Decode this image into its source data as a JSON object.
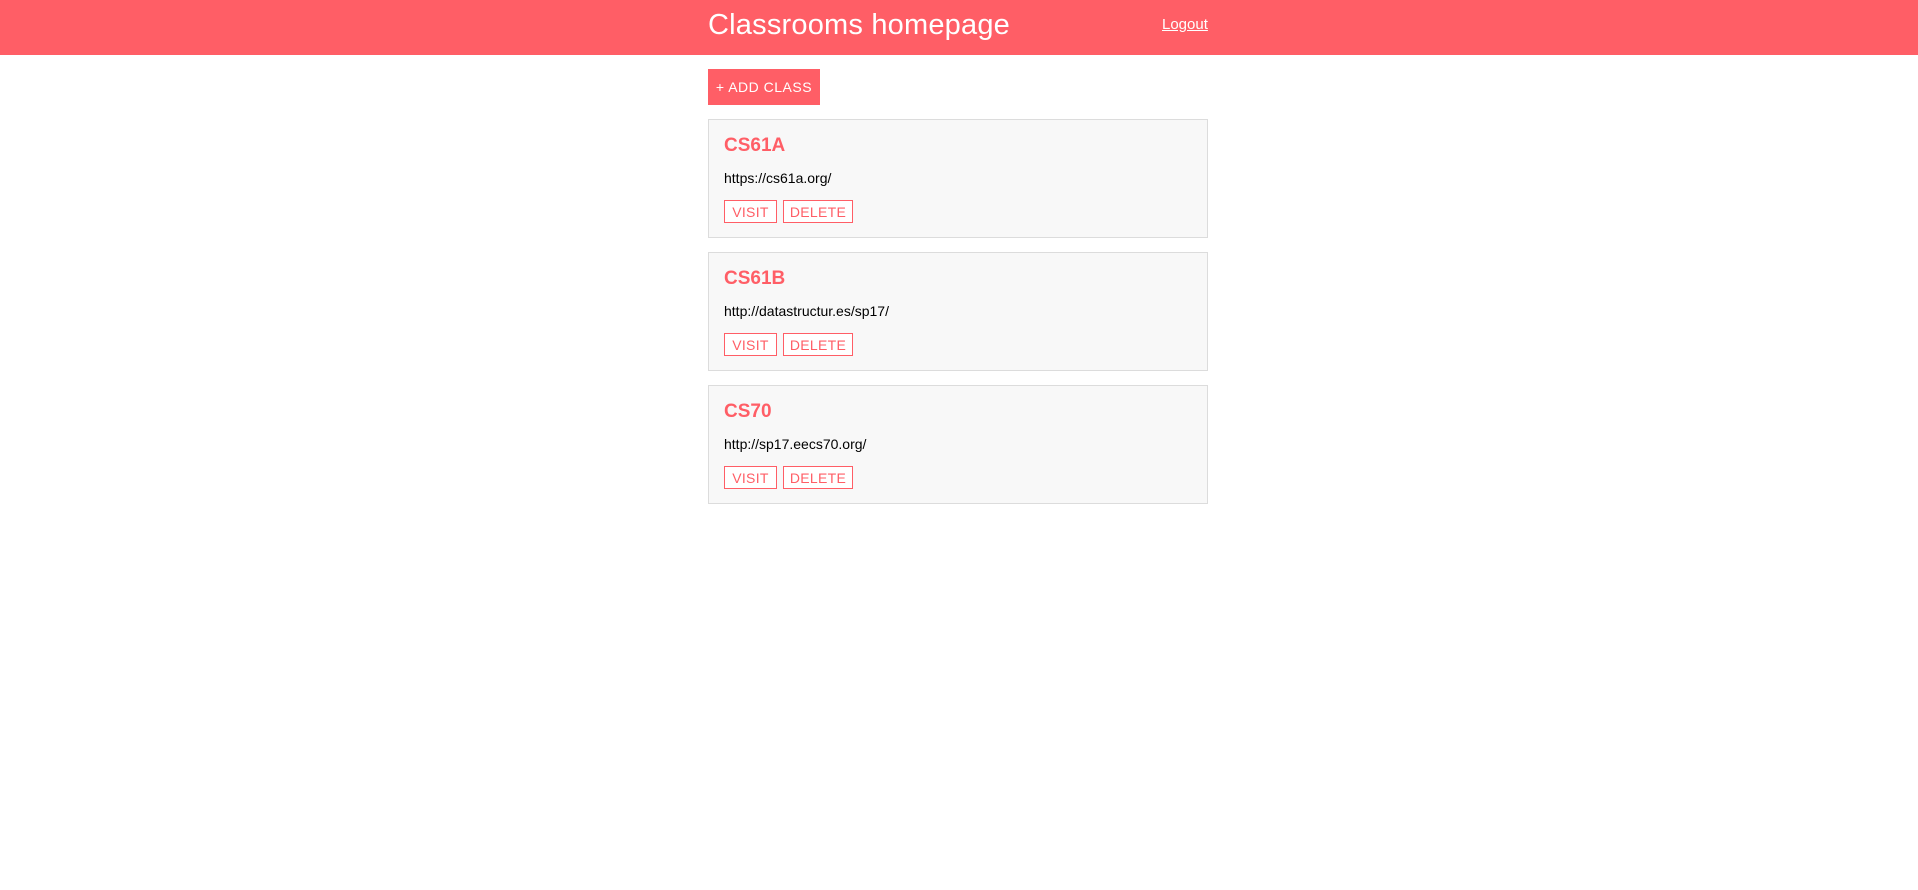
{
  "header": {
    "title": "Classrooms homepage",
    "logout_label": "Logout"
  },
  "toolbar": {
    "add_class_label": "+ ADD CLASS"
  },
  "classes": [
    {
      "name": "CS61A",
      "url": "https://cs61a.org/",
      "visit_label": "VISIT",
      "delete_label": "DELETE"
    },
    {
      "name": "CS61B",
      "url": "http://datastructur.es/sp17/",
      "visit_label": "VISIT",
      "delete_label": "DELETE"
    },
    {
      "name": "CS70",
      "url": "http://sp17.eecs70.org/",
      "visit_label": "VISIT",
      "delete_label": "DELETE"
    }
  ],
  "colors": {
    "accent": "#ff5e66",
    "card_background": "#f8f8f8",
    "card_border": "#dcdcdc"
  }
}
